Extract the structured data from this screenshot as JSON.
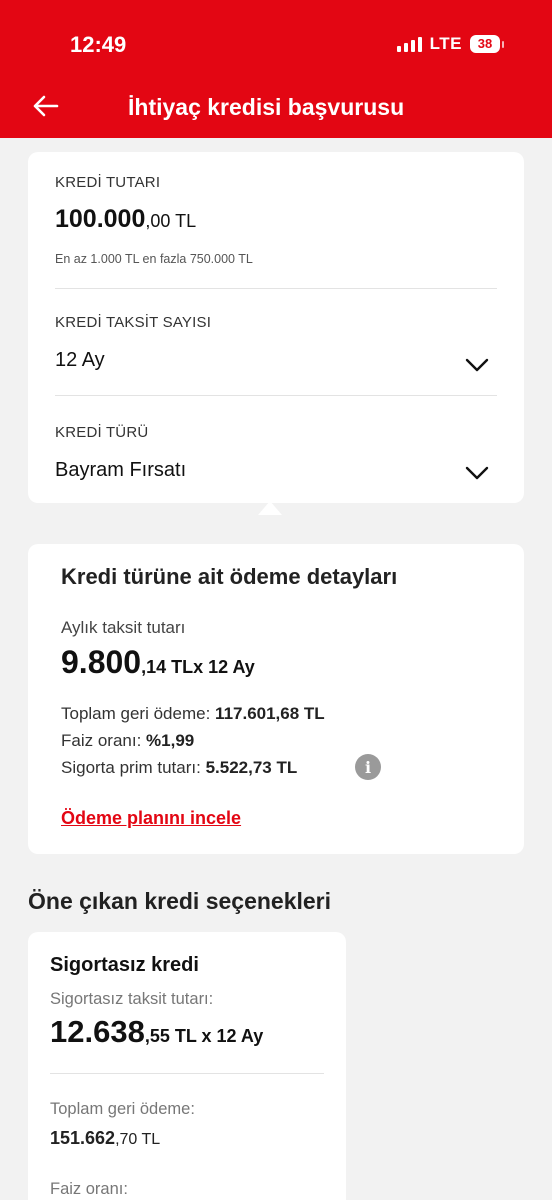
{
  "status": {
    "time": "12:49",
    "network": "LTE",
    "battery": "38"
  },
  "header": {
    "title": "İhtiyaç kredisi başvurusu",
    "back_icon": "arrow-left-icon"
  },
  "form": {
    "amount": {
      "label": "KREDİ TUTARI",
      "value_main": "100.000",
      "value_fraction": ",00 TL",
      "hint": "En az 1.000 TL en fazla 750.000 TL"
    },
    "installments": {
      "label": "KREDİ TAKSİT SAYISI",
      "value": "12 Ay"
    },
    "type": {
      "label": "KREDİ TÜRÜ",
      "value": "Bayram Fırsatı"
    }
  },
  "details": {
    "title": "Kredi türüne ait ödeme detayları",
    "monthly_label": "Aylık taksit tutarı",
    "monthly_main": "9.800",
    "monthly_rest": ",14 TLx 12 Ay",
    "total_label": "Toplam geri ödeme:",
    "total_value": "117.601,68 TL",
    "rate_label": "Faiz oranı:",
    "rate_value": "%1,99",
    "insurance_label": "Sigorta prim tutarı:",
    "insurance_value": "5.522,73 TL",
    "info_glyph": "i",
    "plan_link": "Ödeme planını incele"
  },
  "featured": {
    "title": "Öne çıkan kredi seçenekleri",
    "option": {
      "title": "Sigortasız kredi",
      "installment_label": "Sigortasız taksit tutarı:",
      "installment_main": "12.638",
      "installment_rest": ",55 TL x 12 Ay",
      "total_label": "Toplam geri ödeme:",
      "total_main": "151.662",
      "total_rest": ",70 TL",
      "rate_label": "Faiz oranı:"
    }
  },
  "colors": {
    "brand": "#e30613",
    "background": "#f2f2f2"
  }
}
